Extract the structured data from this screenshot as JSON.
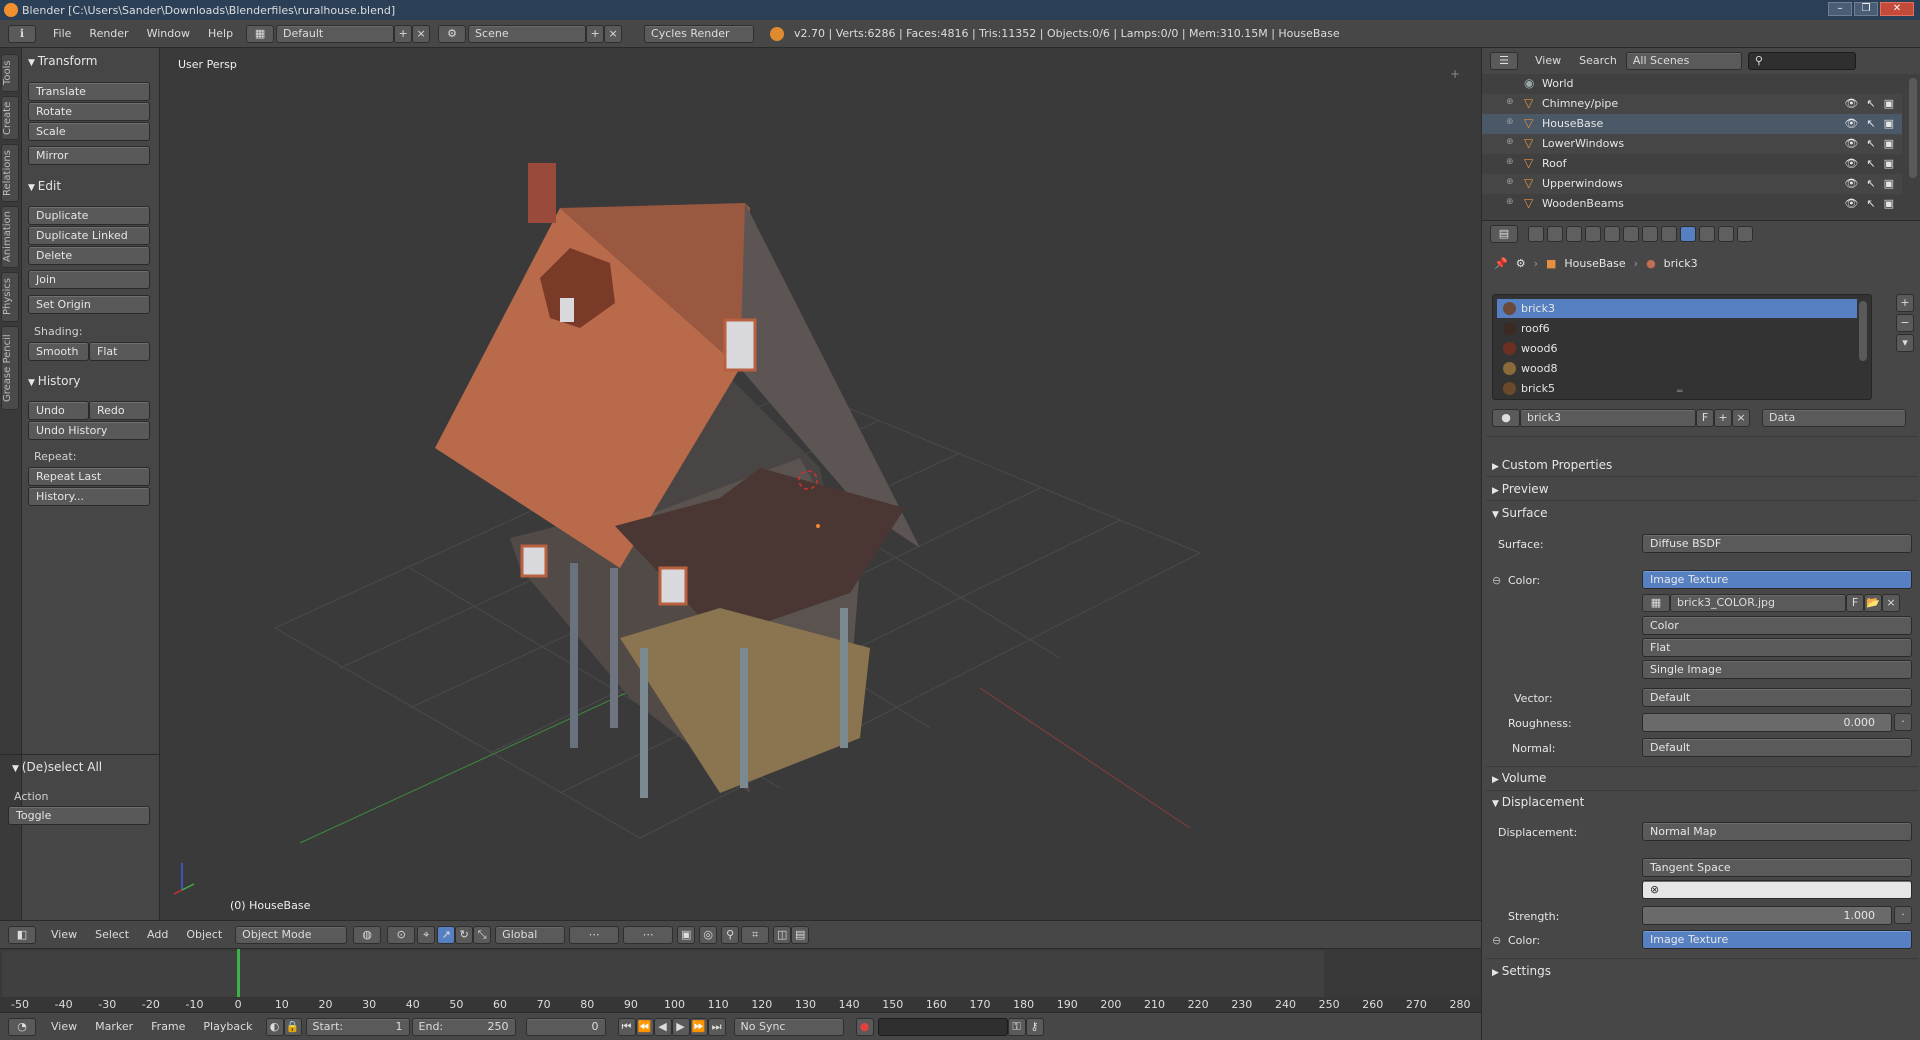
{
  "window": {
    "title": "Blender [C:\\Users\\Sander\\Downloads\\Blenderfiles\\ruralhouse.blend]",
    "controls": [
      "–",
      "❐",
      "✕"
    ]
  },
  "info_header": {
    "menus": [
      "File",
      "Render",
      "Window",
      "Help"
    ],
    "layout": "Default",
    "scene": "Scene",
    "engine": "Cycles Render",
    "stats": "v2.70 | Verts:6286 | Faces:4816 | Tris:11352 | Objects:0/6 | Lamps:0/0 | Mem:310.15M | HouseBase"
  },
  "tool_tabs": [
    "Tools",
    "Create",
    "Relations",
    "Animation",
    "Physics",
    "Grease Pencil"
  ],
  "tool_shelf": {
    "transform_header": "Transform",
    "translate": "Translate",
    "rotate": "Rotate",
    "scale": "Scale",
    "mirror": "Mirror",
    "edit_header": "Edit",
    "duplicate": "Duplicate",
    "duplicate_linked": "Duplicate Linked",
    "delete": "Delete",
    "join": "Join",
    "set_origin": "Set Origin",
    "shading_label": "Shading:",
    "smooth": "Smooth",
    "flat": "Flat",
    "history_header": "History",
    "undo": "Undo",
    "redo": "Redo",
    "undo_history": "Undo History",
    "repeat_label": "Repeat:",
    "repeat_last": "Repeat Last",
    "history": "History...",
    "operator_header": "(De)select All",
    "action_label": "Action",
    "action_value": "Toggle"
  },
  "viewport": {
    "label": "User Persp",
    "active_object": "(0) HouseBase"
  },
  "view3d_header": {
    "menus": [
      "View",
      "Select",
      "Add",
      "Object"
    ],
    "mode": "Object Mode",
    "orientation": "Global"
  },
  "timeline": {
    "ticks": [
      -50,
      -40,
      -30,
      -20,
      -10,
      0,
      10,
      20,
      30,
      40,
      50,
      60,
      70,
      80,
      90,
      100,
      110,
      120,
      130,
      140,
      150,
      160,
      170,
      180,
      190,
      200,
      210,
      220,
      230,
      240,
      250,
      260,
      270,
      280
    ],
    "current_frame": 0,
    "menus": [
      "View",
      "Marker",
      "Frame",
      "Playback"
    ],
    "start_label": "Start:",
    "start": "1",
    "end_label": "End:",
    "end": "250",
    "frame": "0",
    "sync": "No Sync"
  },
  "outliner": {
    "menus": [
      "View",
      "Search"
    ],
    "scope": "All Scenes",
    "items": [
      "World",
      "Chimney/pipe",
      "HouseBase",
      "LowerWindows",
      "Roof",
      "Upperwindows",
      "WoodenBeams"
    ],
    "selected": "HouseBase"
  },
  "properties": {
    "breadcrumb_object": "HouseBase",
    "breadcrumb_material": "brick3",
    "materials": [
      {
        "name": "brick3",
        "color": "#6b4a3a"
      },
      {
        "name": "roof6",
        "color": "#3a2a22"
      },
      {
        "name": "wood6",
        "color": "#6e3020"
      },
      {
        "name": "wood8",
        "color": "#8a6a3a"
      },
      {
        "name": "brick5",
        "color": "#6a4a2a"
      }
    ],
    "material_name": "brick3",
    "fake_user": "F",
    "link": "Data",
    "custom_properties": "Custom Properties",
    "preview": "Preview",
    "surface_section": "Surface",
    "surface_label": "Surface:",
    "surface_value": "Diffuse BSDF",
    "color_label": "Color:",
    "color_value": "Image Texture",
    "image_name": "brick3_COLOR.jpg",
    "color_space": "Color",
    "projection": "Flat",
    "source": "Single Image",
    "vector_label": "Vector:",
    "vector_value": "Default",
    "roughness_label": "Roughness:",
    "roughness_value": "0.000",
    "normal_label": "Normal:",
    "normal_value": "Default",
    "volume_section": "Volume",
    "displacement_section": "Displacement",
    "displacement_label": "Displacement:",
    "displacement_value": "Normal Map",
    "space_value": "Tangent Space",
    "strength_label": "Strength:",
    "strength_value": "1.000",
    "color2_label": "Color:",
    "color2_value": "Image Texture",
    "settings_section": "Settings"
  },
  "colors": {
    "accent_blue": "#5680c2",
    "current_frame": "#3fb14a",
    "object_orange": "#e59040"
  }
}
